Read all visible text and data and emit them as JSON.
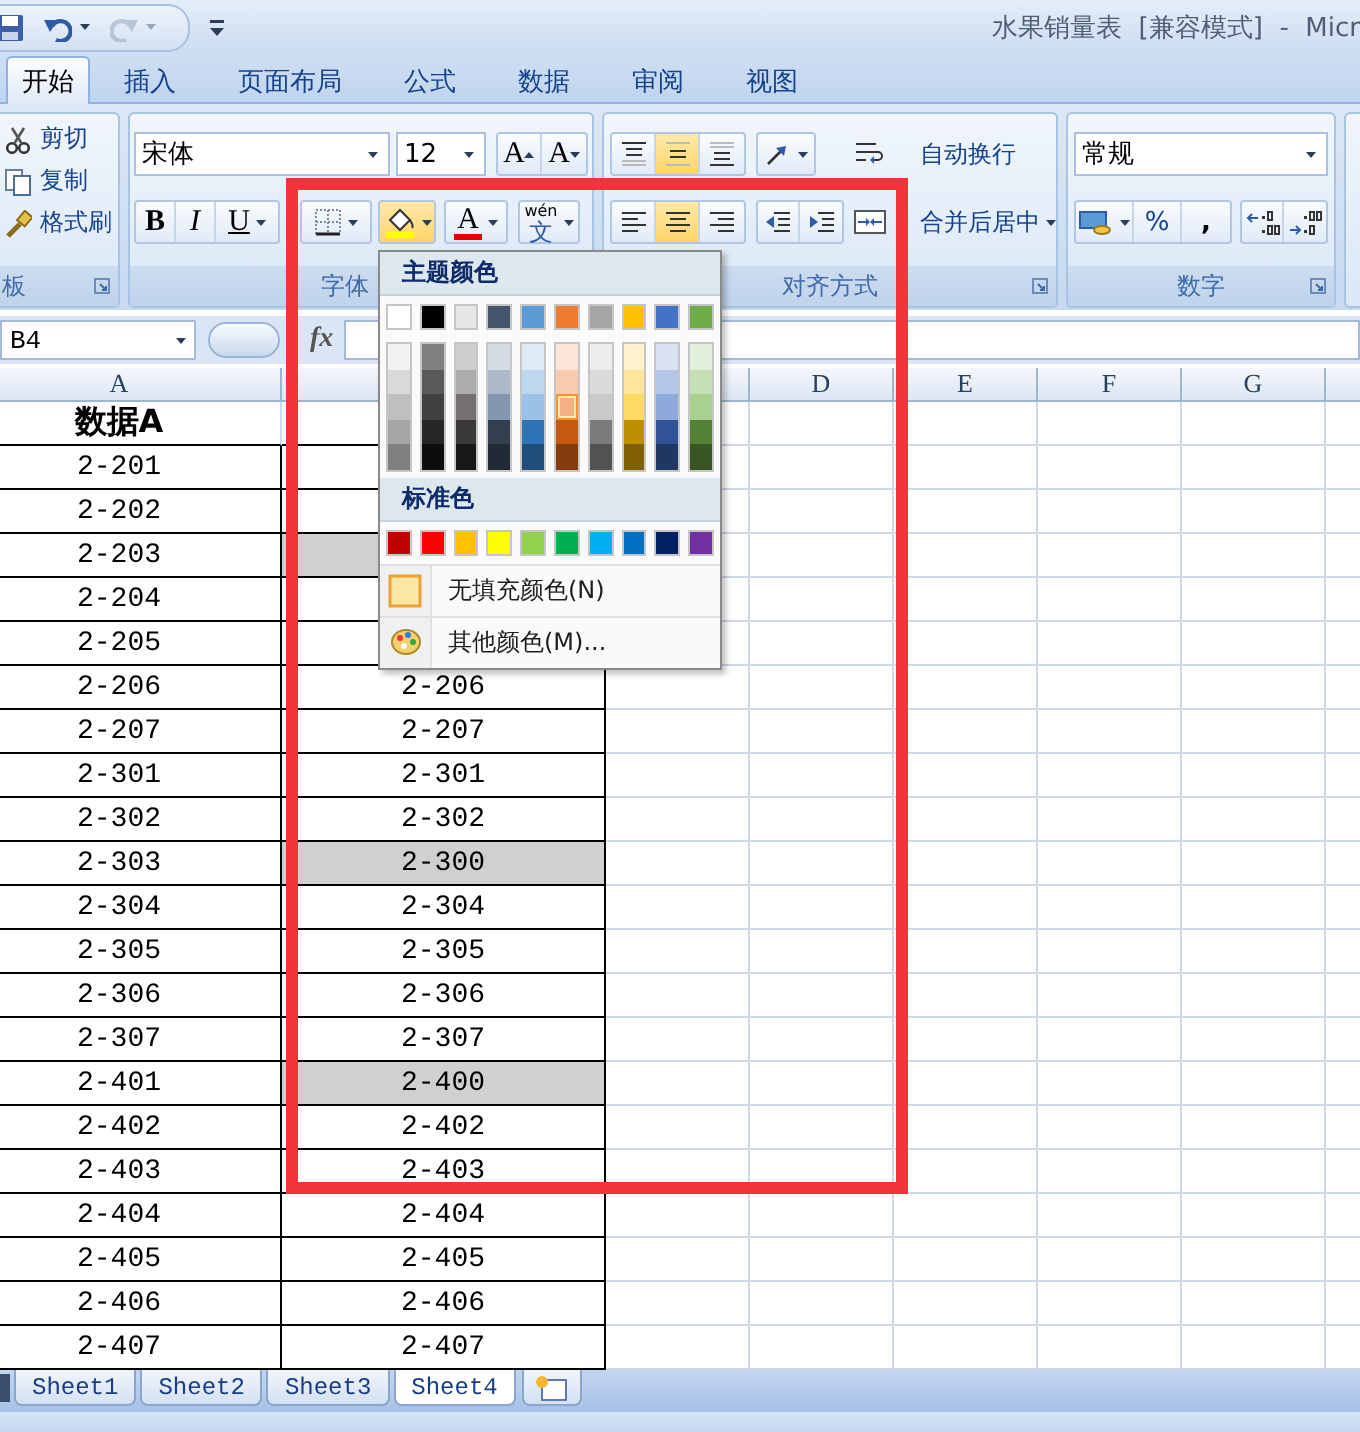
{
  "window": {
    "title": "水果销量表  [兼容模式]  -  Micr"
  },
  "quick_access": [
    {
      "kind": "save",
      "disabled": false
    },
    {
      "kind": "undo",
      "disabled": false
    },
    {
      "kind": "redo",
      "disabled": true
    },
    {
      "kind": "customize",
      "disabled": false
    }
  ],
  "tabs": [
    {
      "label": "开始",
      "selected": true
    },
    {
      "label": "插入",
      "selected": false
    },
    {
      "label": "页面布局",
      "selected": false
    },
    {
      "label": "公式",
      "selected": false
    },
    {
      "label": "数据",
      "selected": false
    },
    {
      "label": "审阅",
      "selected": false
    },
    {
      "label": "视图",
      "selected": false
    }
  ],
  "ribbon": {
    "clipboard": {
      "label": "板",
      "buttons": [
        {
          "kind": "cut",
          "label": "剪切"
        },
        {
          "kind": "copy",
          "label": "复制"
        },
        {
          "kind": "format_painter",
          "label": "格式刷"
        }
      ]
    },
    "font": {
      "label": "字体",
      "font_name": "宋体",
      "font_size": "12",
      "grow_label": "A",
      "shrink_label": "A",
      "styles": [
        {
          "kind": "bold",
          "label": "B"
        },
        {
          "kind": "italic",
          "label": "I"
        },
        {
          "kind": "underline",
          "label": "U"
        }
      ],
      "fill_color": {
        "open": true
      },
      "font_color": {
        "label": "A"
      },
      "phonetic": {
        "label": "文",
        "pinyin": "wén"
      }
    },
    "alignment": {
      "label": "对齐方式",
      "buttons": [
        {
          "kind": "top",
          "selected": false
        },
        {
          "kind": "middle",
          "selected": true
        },
        {
          "kind": "bottom",
          "selected": false
        },
        {
          "kind": "orientation",
          "selected": false
        },
        {
          "kind": "left",
          "selected": false
        },
        {
          "kind": "center",
          "selected": true
        },
        {
          "kind": "right",
          "selected": false
        },
        {
          "kind": "outdent",
          "selected": false
        },
        {
          "kind": "indent",
          "selected": false
        }
      ],
      "wrap_text": "自动换行",
      "merge_center": "合并后居中"
    },
    "number": {
      "label": "数字",
      "format": "常规",
      "buttons": [
        {
          "kind": "currency"
        },
        {
          "kind": "percent",
          "label": "%"
        },
        {
          "kind": "comma",
          "label": ","
        },
        {
          "kind": "increase_decimal"
        },
        {
          "kind": "decrease_decimal"
        }
      ]
    }
  },
  "formula_bar": {
    "name_box": "B4",
    "function_label": "fx"
  },
  "sheet": {
    "columns": [
      "A",
      null,
      null,
      "D",
      "E",
      "F",
      "G"
    ],
    "rows": [
      {
        "kind": "header",
        "a": "数据A",
        "b": null,
        "shaded": false
      },
      {
        "kind": "data",
        "a": "2-201",
        "b": null,
        "shaded": false
      },
      {
        "kind": "data",
        "a": "2-202",
        "b": null,
        "shaded": false
      },
      {
        "kind": "data",
        "a": "2-203",
        "b": null,
        "shaded": true
      },
      {
        "kind": "data",
        "a": "2-204",
        "b": null,
        "shaded": false
      },
      {
        "kind": "data",
        "a": "2-205",
        "b": null,
        "shaded": false
      },
      {
        "kind": "data",
        "a": "2-206",
        "b": "2-206",
        "shaded": false
      },
      {
        "kind": "data",
        "a": "2-207",
        "b": "2-207",
        "shaded": false
      },
      {
        "kind": "data",
        "a": "2-301",
        "b": "2-301",
        "shaded": false
      },
      {
        "kind": "data",
        "a": "2-302",
        "b": "2-302",
        "shaded": false
      },
      {
        "kind": "data",
        "a": "2-303",
        "b": "2-300",
        "shaded": true
      },
      {
        "kind": "data",
        "a": "2-304",
        "b": "2-304",
        "shaded": false
      },
      {
        "kind": "data",
        "a": "2-305",
        "b": "2-305",
        "shaded": false
      },
      {
        "kind": "data",
        "a": "2-306",
        "b": "2-306",
        "shaded": false
      },
      {
        "kind": "data",
        "a": "2-307",
        "b": "2-307",
        "shaded": false
      },
      {
        "kind": "data",
        "a": "2-401",
        "b": "2-400",
        "shaded": true
      },
      {
        "kind": "data",
        "a": "2-402",
        "b": "2-402",
        "shaded": false
      },
      {
        "kind": "data",
        "a": "2-403",
        "b": "2-403",
        "shaded": false
      },
      {
        "kind": "data",
        "a": "2-404",
        "b": "2-404",
        "shaded": false
      },
      {
        "kind": "data",
        "a": "2-405",
        "b": "2-405",
        "shaded": false
      },
      {
        "kind": "data",
        "a": "2-406",
        "b": "2-406",
        "shaded": false
      },
      {
        "kind": "data",
        "a": "2-407",
        "b": "2-407",
        "shaded": false
      }
    ]
  },
  "sheet_tabs": [
    {
      "label": "Sheet1",
      "selected": false
    },
    {
      "label": "Sheet2",
      "selected": false
    },
    {
      "label": "Sheet3",
      "selected": false
    },
    {
      "label": "Sheet4",
      "selected": true
    }
  ],
  "color_menu": {
    "theme_title": "主题颜色",
    "theme_colors": [
      {
        "color": "#ffffff",
        "selected": false
      },
      {
        "color": "#000000",
        "selected": false
      },
      {
        "color": "#e7e6e6",
        "selected": false
      },
      {
        "color": "#44546a",
        "selected": false
      },
      {
        "color": "#5b9bd5",
        "selected": false
      },
      {
        "color": "#ed7d31",
        "selected": false
      },
      {
        "color": "#a5a5a5",
        "selected": false
      },
      {
        "color": "#ffc000",
        "selected": false
      },
      {
        "color": "#4472c4",
        "selected": false
      },
      {
        "color": "#70ad47",
        "selected": false
      }
    ],
    "shades": [
      [
        {
          "color": "#f2f2f2",
          "selected": false
        },
        {
          "color": "#d9d9d9",
          "selected": false
        },
        {
          "color": "#bfbfbf",
          "selected": false
        },
        {
          "color": "#a6a6a6",
          "selected": false
        },
        {
          "color": "#808080",
          "selected": false
        }
      ],
      [
        {
          "color": "#808080",
          "selected": false
        },
        {
          "color": "#595959",
          "selected": false
        },
        {
          "color": "#404040",
          "selected": false
        },
        {
          "color": "#262626",
          "selected": false
        },
        {
          "color": "#0d0d0d",
          "selected": false
        }
      ],
      [
        {
          "color": "#d0cece",
          "selected": false
        },
        {
          "color": "#aeabab",
          "selected": false
        },
        {
          "color": "#757171",
          "selected": false
        },
        {
          "color": "#3b3838",
          "selected": false
        },
        {
          "color": "#181717",
          "selected": false
        }
      ],
      [
        {
          "color": "#d6dce4",
          "selected": false
        },
        {
          "color": "#adb9ca",
          "selected": false
        },
        {
          "color": "#8497b0",
          "selected": false
        },
        {
          "color": "#333f4f",
          "selected": false
        },
        {
          "color": "#222b35",
          "selected": false
        }
      ],
      [
        {
          "color": "#ddebf7",
          "selected": false
        },
        {
          "color": "#bdd7ee",
          "selected": false
        },
        {
          "color": "#9bc2e6",
          "selected": false
        },
        {
          "color": "#2f75b5",
          "selected": false
        },
        {
          "color": "#1f4e78",
          "selected": false
        }
      ],
      [
        {
          "color": "#fce4d6",
          "selected": false
        },
        {
          "color": "#f8cbad",
          "selected": false
        },
        {
          "color": "#f4b084",
          "selected": true
        },
        {
          "color": "#c65911",
          "selected": false
        },
        {
          "color": "#833c0c",
          "selected": false
        }
      ],
      [
        {
          "color": "#ededed",
          "selected": false
        },
        {
          "color": "#dbdbdb",
          "selected": false
        },
        {
          "color": "#c9c9c9",
          "selected": false
        },
        {
          "color": "#7b7b7b",
          "selected": false
        },
        {
          "color": "#525252",
          "selected": false
        }
      ],
      [
        {
          "color": "#fff2cc",
          "selected": false
        },
        {
          "color": "#ffe699",
          "selected": false
        },
        {
          "color": "#ffd966",
          "selected": false
        },
        {
          "color": "#bf8f00",
          "selected": false
        },
        {
          "color": "#806000",
          "selected": false
        }
      ],
      [
        {
          "color": "#d9e1f2",
          "selected": false
        },
        {
          "color": "#b4c6e7",
          "selected": false
        },
        {
          "color": "#8ea9db",
          "selected": false
        },
        {
          "color": "#305496",
          "selected": false
        },
        {
          "color": "#203764",
          "selected": false
        }
      ],
      [
        {
          "color": "#e2efda",
          "selected": false
        },
        {
          "color": "#c6e0b4",
          "selected": false
        },
        {
          "color": "#a9d08e",
          "selected": false
        },
        {
          "color": "#548235",
          "selected": false
        },
        {
          "color": "#375623",
          "selected": false
        }
      ]
    ],
    "standard_title": "标准色",
    "standard_colors": [
      {
        "color": "#c00000",
        "selected": false
      },
      {
        "color": "#ff0000",
        "selected": false
      },
      {
        "color": "#ffc000",
        "selected": false
      },
      {
        "color": "#ffff00",
        "selected": false
      },
      {
        "color": "#92d050",
        "selected": false
      },
      {
        "color": "#00b050",
        "selected": false
      },
      {
        "color": "#00b0f0",
        "selected": false
      },
      {
        "color": "#0070c0",
        "selected": false
      },
      {
        "color": "#002060",
        "selected": false
      },
      {
        "color": "#7030a0",
        "selected": false
      }
    ],
    "items": [
      {
        "kind": "no_fill",
        "label": "无填充颜色(N)"
      },
      {
        "kind": "more",
        "label": "其他颜色(M)..."
      }
    ]
  },
  "annotation": {
    "kind": "frame"
  }
}
